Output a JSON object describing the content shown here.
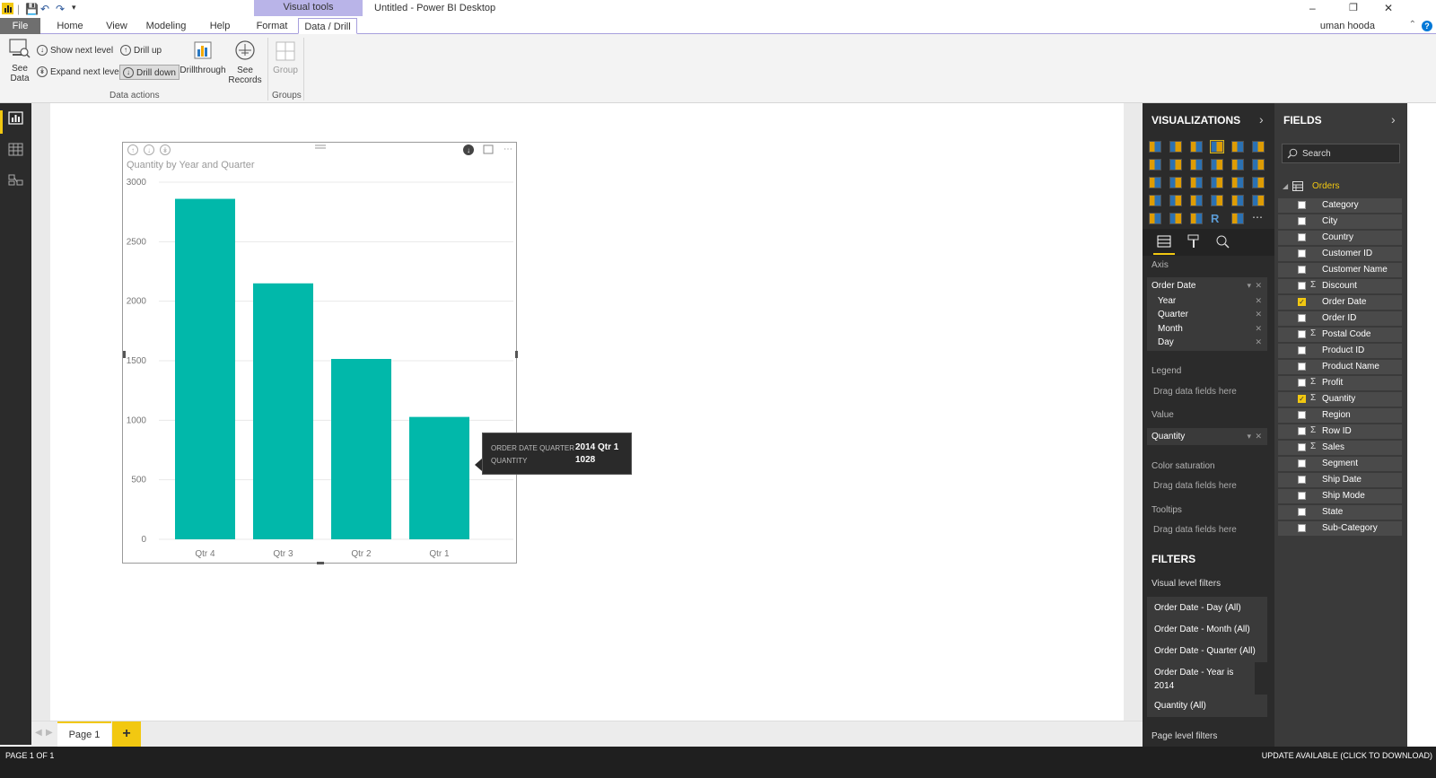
{
  "window": {
    "title": "Untitled - Power BI Desktop",
    "visual_tools": "Visual tools",
    "user": "uman hooda"
  },
  "tabs": [
    "File",
    "Home",
    "View",
    "Modeling",
    "Help",
    "Format",
    "Data / Drill"
  ],
  "ribbon": {
    "see_data": "See Data",
    "show_next_level": "Show next level",
    "expand_next_level": "Expand next level",
    "drill_up": "Drill up",
    "drill_down": "Drill down",
    "drillthrough": "Drillthrough",
    "see_records": "See Records",
    "group": "Group",
    "group_data_actions": "Data actions",
    "group_groups": "Groups"
  },
  "chart_data": {
    "type": "bar",
    "title": "Quantity by Year and Quarter",
    "categories": [
      "Qtr 4",
      "Qtr 3",
      "Qtr 2",
      "Qtr 1"
    ],
    "values": [
      2860,
      2150,
      1515,
      1028
    ],
    "yticks": [
      "0",
      "500",
      "1000",
      "1500",
      "2000",
      "2500",
      "3000"
    ],
    "ylim": [
      0,
      3000
    ],
    "color": "#01b8aa",
    "grid": true
  },
  "tooltip": {
    "label1": "ORDER DATE QUARTER",
    "value1": "2014 Qtr 1",
    "label2": "QUANTITY",
    "value2": "1028"
  },
  "page": {
    "tab": "Page 1",
    "add": "+"
  },
  "status": {
    "left": "PAGE 1 OF 1",
    "right": "UPDATE AVAILABLE (CLICK TO DOWNLOAD)"
  },
  "visualizations": {
    "header": "VISUALIZATIONS",
    "axis_label": "Axis",
    "axis_field": "Order Date",
    "axis_levels": [
      "Year",
      "Quarter",
      "Month",
      "Day"
    ],
    "legend_label": "Legend",
    "value_label": "Value",
    "value_field": "Quantity",
    "color_sat_label": "Color saturation",
    "tooltips_label": "Tooltips",
    "drag_text": "Drag data fields here"
  },
  "filters": {
    "header": "FILTERS",
    "visual_level": "Visual level filters",
    "items": [
      "Order Date - Day (All)",
      "Order Date - Month (All)",
      "Order Date - Quarter (All)",
      "Order Date - Year is 2014",
      "Quantity (All)"
    ],
    "page_level": "Page level filters"
  },
  "fields": {
    "header": "FIELDS",
    "search_placeholder": "Search",
    "table": "Orders",
    "items": [
      {
        "name": "Category",
        "sigma": false,
        "checked": false
      },
      {
        "name": "City",
        "sigma": false,
        "checked": false
      },
      {
        "name": "Country",
        "sigma": false,
        "checked": false
      },
      {
        "name": "Customer ID",
        "sigma": false,
        "checked": false
      },
      {
        "name": "Customer Name",
        "sigma": false,
        "checked": false
      },
      {
        "name": "Discount",
        "sigma": true,
        "checked": false
      },
      {
        "name": "Order Date",
        "sigma": false,
        "checked": true
      },
      {
        "name": "Order ID",
        "sigma": false,
        "checked": false
      },
      {
        "name": "Postal Code",
        "sigma": true,
        "checked": false
      },
      {
        "name": "Product ID",
        "sigma": false,
        "checked": false
      },
      {
        "name": "Product Name",
        "sigma": false,
        "checked": false
      },
      {
        "name": "Profit",
        "sigma": true,
        "checked": false
      },
      {
        "name": "Quantity",
        "sigma": true,
        "checked": true
      },
      {
        "name": "Region",
        "sigma": false,
        "checked": false
      },
      {
        "name": "Row ID",
        "sigma": true,
        "checked": false
      },
      {
        "name": "Sales",
        "sigma": true,
        "checked": false
      },
      {
        "name": "Segment",
        "sigma": false,
        "checked": false
      },
      {
        "name": "Ship Date",
        "sigma": false,
        "checked": false
      },
      {
        "name": "Ship Mode",
        "sigma": false,
        "checked": false
      },
      {
        "name": "State",
        "sigma": false,
        "checked": false
      },
      {
        "name": "Sub-Category",
        "sigma": false,
        "checked": false
      }
    ]
  }
}
